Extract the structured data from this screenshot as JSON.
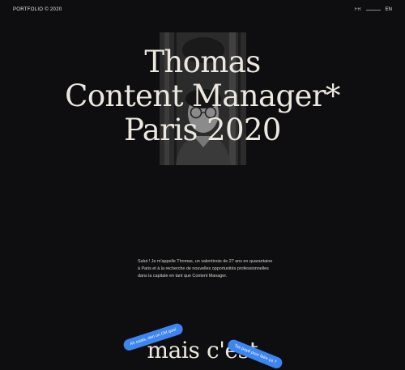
{
  "header": {
    "brand": "PORTFOLIO © 2020",
    "lang_fr": "FR",
    "lang_en": "EN"
  },
  "hero": {
    "line1": "Thomas",
    "line2": "Content Manager*",
    "line3": "Paris 2020"
  },
  "intro": {
    "text": "Salut ! Je m'appelle Thomas, un valentinois de 27 ans en quarantaine à Paris et à la recherche de nouvelles opportunités professionnelles dans la capitale en tant que Content Manager."
  },
  "section": {
    "big_text": "mais c'est"
  },
  "bubbles": {
    "left": "Ah ouais, rien un CM quoi",
    "right": "Tes payé pour faire ça ?"
  },
  "colors": {
    "background": "#0e0e10",
    "text": "#ece8e0",
    "bubble": "#3d86f2"
  }
}
